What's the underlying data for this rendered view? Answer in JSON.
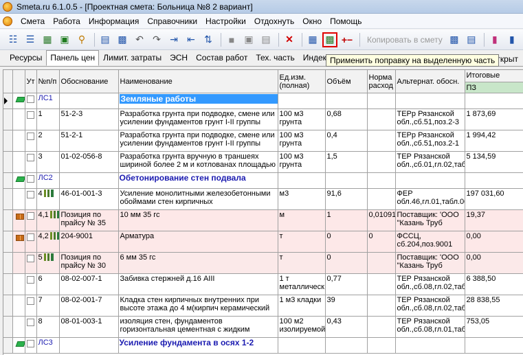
{
  "window": {
    "title": "Smeta.ru  6.1.0.5  - [Проектная смета: Больница №8 2 вариант]"
  },
  "menu": [
    "Смета",
    "Работа",
    "Информация",
    "Справочники",
    "Настройки",
    "Отдохнуть",
    "Окно",
    "Помощь"
  ],
  "toolbar": {
    "copy_label": "Копировать в смету",
    "icons": [
      "tree-icon",
      "tree-add-icon",
      "table-icon",
      "excel-icon",
      "search-icon",
      "save-icon",
      "save-all-icon",
      "undo-icon",
      "delete-undo-icon",
      "indent-icon",
      "outdent-icon",
      "move-icon",
      "box-icon",
      "box2-icon",
      "paste-icon",
      "delete-icon",
      "calculator-icon",
      "apply-correction-icon",
      "add-minus-icon",
      "copy-icon",
      "copy2-icon",
      "book-red-icon",
      "book-blue-icon"
    ]
  },
  "tabs": [
    "Ресурсы",
    "Панель цен",
    "Лимит. затраты",
    "ЭСН",
    "Состав работ",
    "Тех. часть",
    "Индексы"
  ],
  "active_tab": "Панель цен",
  "tooltip": "Применить поправку на выделенную часть",
  "tab_tail": "открыт",
  "grid": {
    "headers": {
      "ut": "Ут",
      "num": "№п/п",
      "basis": "Обоснование",
      "name": "Наименование",
      "unit": "Ед.изм. (полная)",
      "volume": "Объём",
      "norm": "Норма расход",
      "alt": "Альтернат. обосн.",
      "total": "Итоговые",
      "total_sub": "ПЗ"
    },
    "rows": [
      {
        "kind": "section",
        "code": "ЛС1",
        "name": "Земляные работы",
        "selected": true
      },
      {
        "num": "1",
        "basis": "51-2-3",
        "name": "Разработка грунта при подводке, смене или усилении фундаментов грунт I-II группы",
        "unit": "100 м3 грунта",
        "volume": "0,68",
        "norm": "",
        "alt": "ТЕРр Рязанской обл.,сб.51,поз.2-3",
        "total": "1 873,69"
      },
      {
        "num": "2",
        "basis": "51-2-1",
        "name": "Разработка грунта при подводке, смене или усилении фундаментов грунт I-II группы",
        "unit": "100 м3 грунта",
        "volume": "0,4",
        "norm": "",
        "alt": "ТЕРр Рязанской обл.,сб.51,поз.2-1",
        "total": "1 994,42"
      },
      {
        "num": "3",
        "basis": "01-02-056-8",
        "name": "Разработка грунта вручную в траншеях шириной более 2 м и котлованах площадью",
        "unit": "100 м3 грунта",
        "volume": "1,5",
        "norm": "",
        "alt": "ТЕР Рязанской обл.,сб.01,гл.02,таб",
        "total": "5 134,59"
      },
      {
        "kind": "section",
        "code": "ЛС2",
        "name": "Обетонирование стен подвала"
      },
      {
        "num": "4",
        "bar": true,
        "basis": "46-01-001-3",
        "name": "Усиление монолитными железобетонными обоймами стен кирпичных",
        "unit": "м3",
        "volume": "91,6",
        "norm": "",
        "alt": "ФЕР обл.46,гл.01,табл.00",
        "total": "197 031,60"
      },
      {
        "kind": "res",
        "num": "4,1",
        "bar": true,
        "basis": "Позиция по прайсу № 35",
        "name": "10 мм 35 гс",
        "unit": "м",
        "volume": "1",
        "norm": "0,01091",
        "alt": "Поставщик: 'ООО \"Казань Труб",
        "total": "19,37"
      },
      {
        "kind": "res",
        "num": "4,2",
        "bar": true,
        "basis": "204-9001",
        "name": "Арматура",
        "unit": "т",
        "volume": "0",
        "norm": "0",
        "alt": "ФССЦ, сб.204,поз.9001",
        "total": "0,00"
      },
      {
        "kind": "res2",
        "num": "5",
        "bar": true,
        "basis": "Позиция по прайсу № 30",
        "name": "6 мм 35 гс",
        "unit": "т",
        "volume": "0",
        "norm": "",
        "alt": "Поставщик: 'ООО \"Казань Труб",
        "total": "0,00"
      },
      {
        "num": "6",
        "basis": "08-02-007-1",
        "name": "Забивка стержней д.16 AIII",
        "unit": "1 т металлическ",
        "volume": "0,77",
        "norm": "",
        "alt": "ТЕР Рязанской обл.,сб.08,гл.02,таб",
        "total": "6 388,50"
      },
      {
        "num": "7",
        "basis": "08-02-001-7",
        "name": "Кладка стен кирпичных внутренних при высоте этажа до 4 м(кирпич керамический",
        "unit": "1 м3 кладки",
        "volume": "39",
        "norm": "",
        "alt": "ТЕР Рязанской обл.,сб.08,гл.02,таб",
        "total": "28 838,55"
      },
      {
        "num": "8",
        "basis": "08-01-003-1",
        "name": "изоляция стен, фундаментов горизонтальная цементная с жидким",
        "unit": "100 м2 изолируемой",
        "volume": "0,43",
        "norm": "",
        "alt": "ТЕР Рязанской обл.,сб.08,гл.01,таб",
        "total": "753,05"
      },
      {
        "kind": "section",
        "code": "ЛС3",
        "name": "Усиление фундамента в осях 1-2"
      }
    ]
  }
}
